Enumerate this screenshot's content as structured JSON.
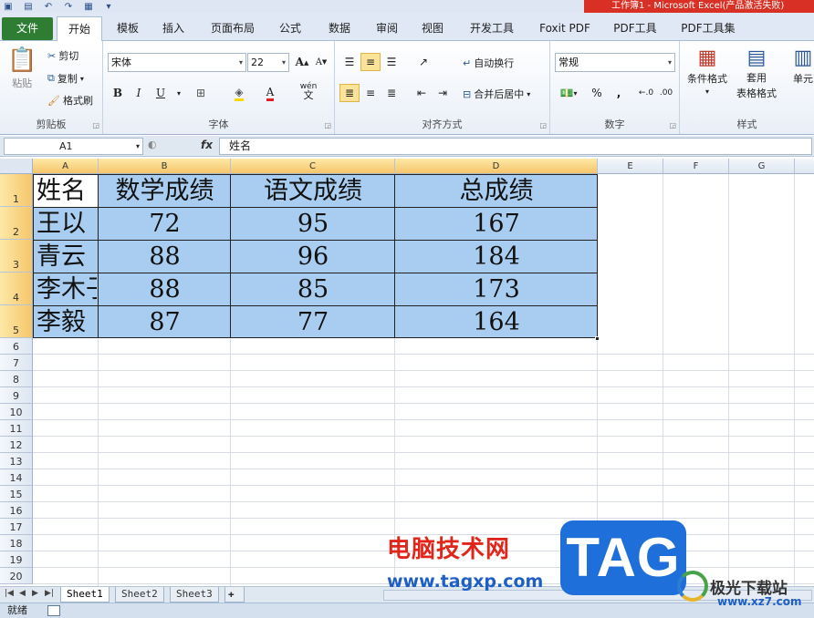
{
  "window": {
    "title": "工作簿1 - Microsoft Excel(产品激活失败)"
  },
  "ribbon_tabs": [
    "文件",
    "开始",
    "模板",
    "插入",
    "页面布局",
    "公式",
    "数据",
    "审阅",
    "视图",
    "开发工具",
    "Foxit PDF",
    "PDF工具",
    "PDF工具集"
  ],
  "clipboard": {
    "paste": "粘贴",
    "cut": "剪切",
    "copy": "复制",
    "format_painter": "格式刷",
    "label": "剪贴板"
  },
  "font": {
    "name": "宋体",
    "size": "22",
    "grow": "A",
    "shrink": "A",
    "bold": "B",
    "italic": "I",
    "underline": "U",
    "wen": "wén",
    "wen_char": "文",
    "label": "字体"
  },
  "alignment": {
    "wrap": "自动换行",
    "merge": "合并后居中",
    "label": "对齐方式"
  },
  "number": {
    "format": "常规",
    "percent": "%",
    "comma": ",",
    "label": "数字"
  },
  "styles": {
    "conditional": "条件格式",
    "apply_line1": "套用",
    "apply_line2": "表格格式",
    "cell_styles": "单元",
    "label": "样式"
  },
  "formula_bar": {
    "name_box": "A1",
    "fx": "fx",
    "content": "姓名"
  },
  "columns": [
    "A",
    "B",
    "C",
    "D",
    "E",
    "F",
    "G"
  ],
  "rows": [
    "1",
    "2",
    "3",
    "4",
    "5",
    "6",
    "7",
    "8",
    "9",
    "10",
    "11",
    "12",
    "13",
    "14",
    "15",
    "16",
    "17",
    "18",
    "19",
    "20"
  ],
  "table": {
    "header": [
      "姓名",
      "数学成绩",
      "语文成绩",
      "总成绩"
    ],
    "rows": [
      [
        "王以",
        "72",
        "95",
        "167"
      ],
      [
        "青云",
        "88",
        "96",
        "184"
      ],
      [
        "李木子",
        "88",
        "85",
        "173"
      ],
      [
        "李毅",
        "87",
        "77",
        "164"
      ]
    ]
  },
  "sheets": [
    "Sheet1",
    "Sheet2",
    "Sheet3"
  ],
  "status": {
    "ready": "就绪"
  },
  "watermark": {
    "site_name": "电脑技术网",
    "url": "www.tagxp.com",
    "tag": "TAG",
    "logo_name": "极光下载站",
    "logo_url": "www.xz7.com"
  },
  "colors": {
    "selection_fill": "#a8cdf0",
    "file_tab": "#2e7d32",
    "title_bar_red": "#d93025",
    "watermark_red": "#e0261b",
    "watermark_blue": "#1e6fd9"
  }
}
